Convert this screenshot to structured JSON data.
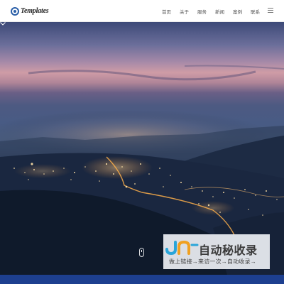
{
  "header": {
    "logo_text": "Templates",
    "nav": [
      "首页",
      "关于",
      "服务",
      "新闻",
      "案例",
      "联系"
    ],
    "menu_icon": "hamburger-menu-icon"
  },
  "hero": {
    "scene": "city-at-dusk-photo",
    "scroll_icon": "mouse-scroll-icon",
    "chevron_icon": "chevron-down-icon"
  },
  "watermark": {
    "title": "自动秘收录",
    "subtitle": "做上链接→来访一次→自动收录→"
  },
  "colors": {
    "accent": "#2a5fa8",
    "bottom_strip": "#1d3f8f",
    "header_bg": "#ffffff"
  }
}
